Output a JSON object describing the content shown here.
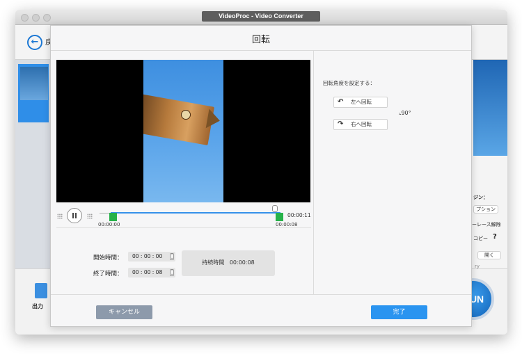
{
  "window": {
    "title": "VideoProc - Video Converter",
    "back_label": "戻"
  },
  "background": {
    "output_label": "出力",
    "right_panel": {
      "engine_heading": "ジン：",
      "option_button": "プション",
      "interlace_label": "ーレース解除",
      "copy_label": "コピー",
      "help_symbol": "?",
      "open_button": "開く",
      "path_fragment": "ry"
    },
    "run_label": "RUN"
  },
  "dialog": {
    "title": "回転",
    "playback": {
      "start_marker": "00:00:00",
      "end_marker": "00:00:08",
      "total_time": "00:00:11",
      "progress_fraction": 0.96
    },
    "trim": {
      "start_label": "開始時間：",
      "start_value": "00 : 00 : 00",
      "end_label": "終了時間：",
      "end_value": "00 : 00 : 08",
      "duration_label": "持続時間",
      "duration_value": "00:00:08"
    },
    "rotation": {
      "heading": "回転角度を設定する：",
      "rotate_left": "左へ回転",
      "rotate_right": "右へ回転",
      "angle": "90°"
    },
    "buttons": {
      "cancel": "キャンセル",
      "ok": "完了"
    }
  }
}
